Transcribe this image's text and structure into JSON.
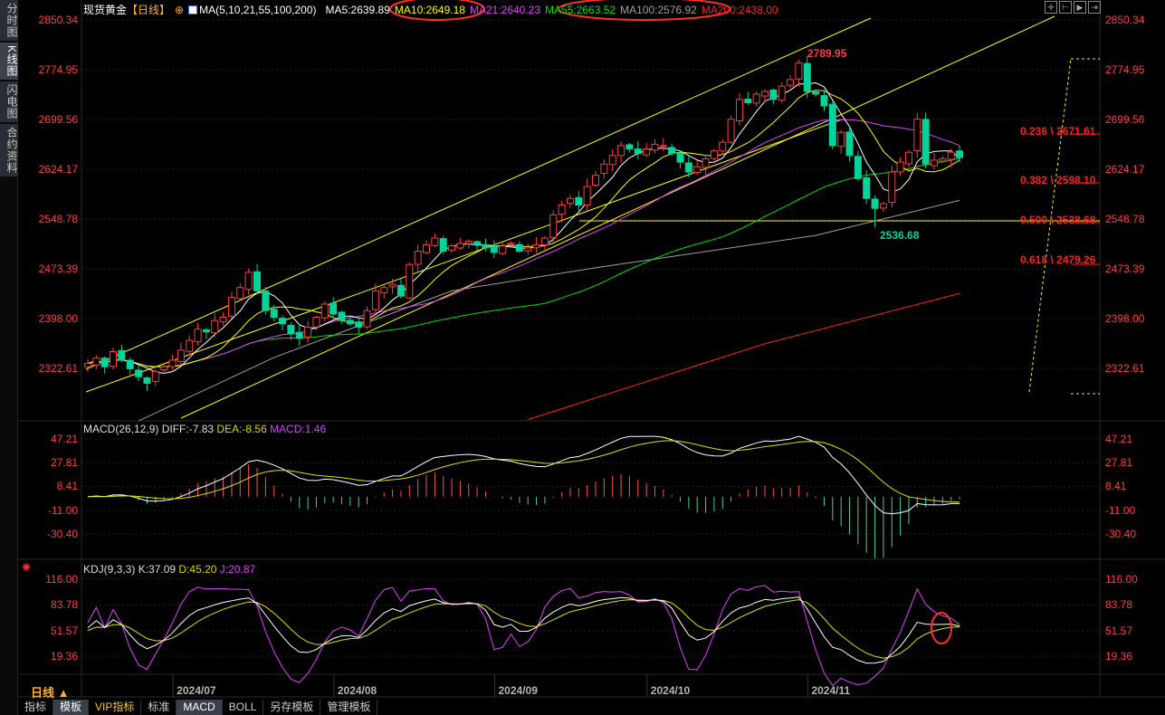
{
  "sidebar": {
    "tabs": [
      {
        "label": "分时图"
      },
      {
        "label": "K线图",
        "active": true
      },
      {
        "label": "闪电图"
      },
      {
        "label": "合约资料"
      }
    ]
  },
  "header": {
    "symbol": "现货黄金",
    "period": "【日线】",
    "ma_label": "MA(5,10,21,55,100,200)",
    "ma5": "MA5:2639.89",
    "ma10": "MA10:2649.18",
    "ma21": "MA21:2640.23",
    "ma55": "MA55:2663.52",
    "ma100": "MA100:2576.92",
    "ma200": "MA200:2438.00"
  },
  "colors": {
    "up": "#ff3c3c",
    "down": "#00d49a",
    "ma5": "#ffffff",
    "ma10": "#ffff00",
    "ma21": "#e040fb",
    "ma55": "#00e000",
    "ma100": "#a0a0a0",
    "ma200": "#ff2020",
    "axis": "#ff3c46"
  },
  "price_axis": [
    "2850.34",
    "2774.95",
    "2699.56",
    "2624.17",
    "2548.78",
    "2473.39",
    "2398.00",
    "2322.61"
  ],
  "macd_axis": [
    "47.21",
    "27.81",
    "8.41",
    "-11.00",
    "-30.40"
  ],
  "kdj_axis": [
    "116.00",
    "83.78",
    "51.57",
    "19.36"
  ],
  "annotations": {
    "high": "2789.95",
    "low": "2536.68"
  },
  "fib": [
    "0.236 \\ 2671.61",
    "0.382 \\ 2598.10",
    "0.500 \\ 2538.68",
    "0.618 \\ 2479.26"
  ],
  "macd": {
    "label": "MACD(26,12,9)",
    "diff": "DIFF:-7.83",
    "dea": "DEA:-8.56",
    "macd": "MACD:1.46"
  },
  "kdj": {
    "label": "KDJ(9,3,3)",
    "k": "K:37.09",
    "d": "D:45.20",
    "j": "J:20.87"
  },
  "period_selector": "日线 ▲",
  "dates": [
    {
      "label": "2024/07",
      "index": 12
    },
    {
      "label": "2024/08",
      "index": 31
    },
    {
      "label": "2024/09",
      "index": 50
    },
    {
      "label": "2024/10",
      "index": 68
    },
    {
      "label": "2024/11",
      "index": 87
    }
  ],
  "bottom_tabs": [
    {
      "label": "指标"
    },
    {
      "label": "模板",
      "on": true
    },
    {
      "label": "VIP指标",
      "vip": true
    },
    {
      "label": "标准"
    },
    {
      "label": "MACD",
      "on": true
    },
    {
      "label": "BOLL"
    },
    {
      "label": "另存模板"
    },
    {
      "label": "管理模板"
    }
  ],
  "chart_data": {
    "type": "candlestick",
    "title": "现货黄金 日线",
    "closes": [
      2330,
      2338,
      2325,
      2348,
      2335,
      2322,
      2310,
      2300,
      2318,
      2325,
      2335,
      2350,
      2365,
      2382,
      2378,
      2395,
      2400,
      2430,
      2445,
      2468,
      2440,
      2410,
      2400,
      2390,
      2375,
      2368,
      2385,
      2400,
      2420,
      2405,
      2395,
      2390,
      2385,
      2410,
      2440,
      2445,
      2450,
      2432,
      2480,
      2500,
      2510,
      2520,
      2500,
      2508,
      2512,
      2515,
      2510,
      2505,
      2498,
      2508,
      2512,
      2500,
      2505,
      2510,
      2520,
      2555,
      2570,
      2580,
      2570,
      2598,
      2615,
      2632,
      2645,
      2660,
      2655,
      2648,
      2655,
      2662,
      2660,
      2648,
      2635,
      2620,
      2628,
      2640,
      2652,
      2665,
      2700,
      2730,
      2725,
      2738,
      2742,
      2730,
      2750,
      2760,
      2785,
      2742,
      2738,
      2720,
      2660,
      2680,
      2645,
      2610,
      2580,
      2565,
      2572,
      2620,
      2635,
      2650,
      2700,
      2632,
      2638,
      2640,
      2650,
      2642
    ],
    "ma100_trace": [
      [
        6,
        2243
      ],
      [
        22,
        2339
      ],
      [
        43,
        2440
      ],
      [
        60,
        2475
      ],
      [
        86,
        2524
      ],
      [
        103,
        2577
      ]
    ],
    "ma200_trace": [
      [
        52,
        2245
      ],
      [
        80,
        2360
      ],
      [
        103,
        2436
      ]
    ],
    "ylim": [
      2322.61,
      2850.34
    ]
  }
}
